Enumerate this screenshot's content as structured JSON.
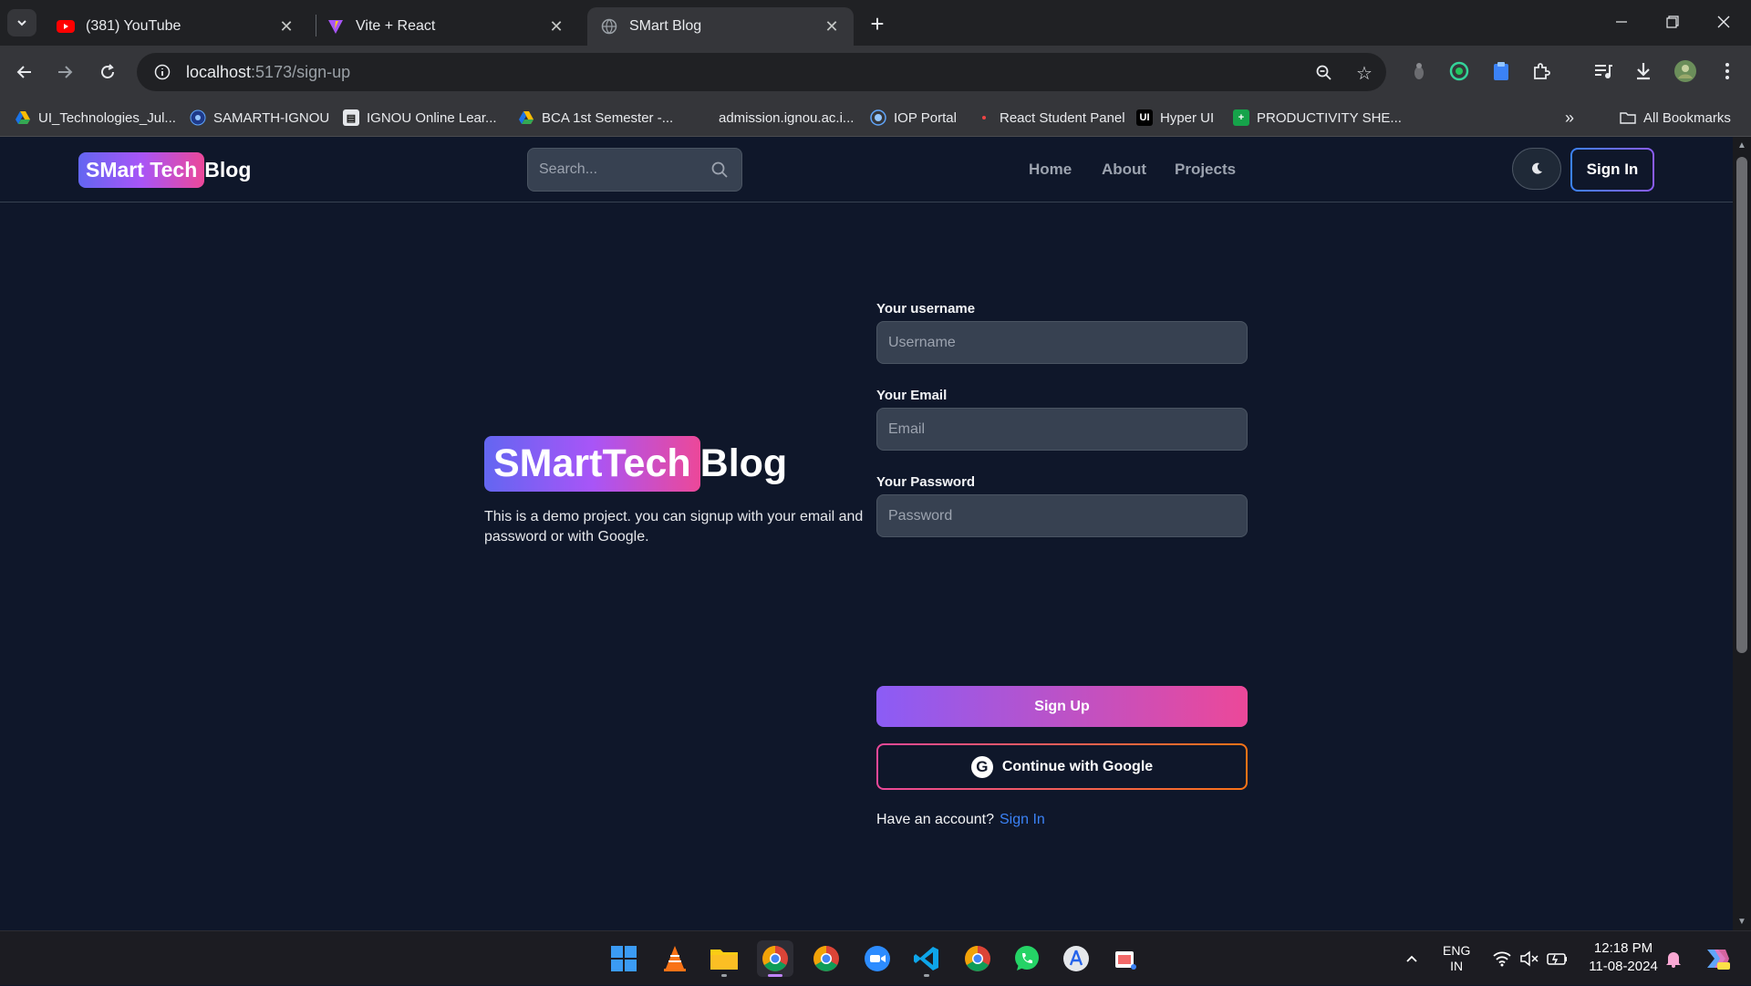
{
  "browser": {
    "tabs": [
      {
        "title": "(381) YouTube"
      },
      {
        "title": "Vite + React"
      },
      {
        "title": "SMart Blog"
      }
    ],
    "url_host": "localhost",
    "url_path": ":5173/sign-up",
    "bookmarks": [
      {
        "label": "UI_Technologies_Jul..."
      },
      {
        "label": "SAMARTH-IGNOU"
      },
      {
        "label": "IGNOU Online Lear..."
      },
      {
        "label": "BCA 1st Semester -..."
      },
      {
        "label": "admission.ignou.ac.i..."
      },
      {
        "label": "IOP Portal"
      },
      {
        "label": "React Student Panel"
      },
      {
        "label": "Hyper UI"
      },
      {
        "label": "PRODUCTIVITY SHE..."
      }
    ],
    "all_bookmarks": "All Bookmarks"
  },
  "header": {
    "logo_grad": "SMart Tech",
    "logo_plain": "Blog",
    "search_placeholder": "Search...",
    "nav": [
      "Home",
      "About",
      "Projects"
    ],
    "signin_label": "Sign In"
  },
  "hero": {
    "brand_grad": "SMartTech",
    "brand_plain": "Blog",
    "description": "This is a demo project. you can signup with your email and password or with Google."
  },
  "form": {
    "username_label": "Your username",
    "username_placeholder": "Username",
    "email_label": "Your Email",
    "email_placeholder": "Email",
    "password_label": "Your Password",
    "password_placeholder": "Password",
    "signup_label": "Sign Up",
    "google_label": "Continue with Google",
    "have_account": "Have an account?",
    "signin_link": "Sign In"
  },
  "taskbar": {
    "lang_top": "ENG",
    "lang_bottom": "IN",
    "time": "12:18 PM",
    "date": "11-08-2024"
  },
  "colors": {
    "page_bg": "#0f172a",
    "accent_purple": "#8b5cf6",
    "accent_pink": "#ec4899",
    "link_blue": "#3b82f6"
  }
}
